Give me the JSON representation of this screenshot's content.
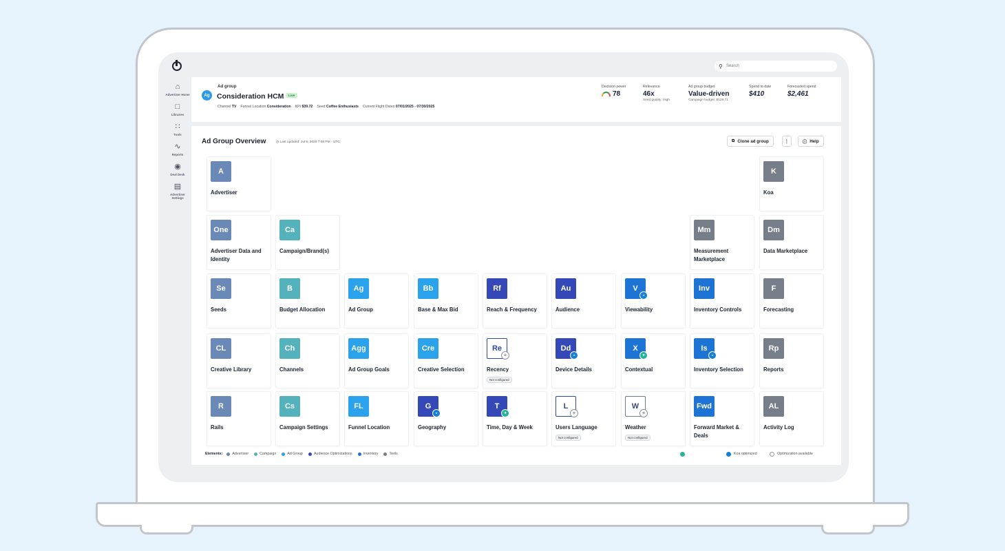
{
  "search": {
    "placeholder": "Search"
  },
  "sidebar": {
    "items": [
      {
        "label": "Advertiser Home",
        "icon": "home-icon"
      },
      {
        "label": "Libraries",
        "icon": "document-icon"
      },
      {
        "label": "Tools",
        "icon": "grid-icon"
      },
      {
        "label": "Reports",
        "icon": "chart-line-icon"
      },
      {
        "label": "Deal Desk",
        "icon": "deal-icon"
      },
      {
        "label": "Advertiser Settings",
        "icon": "settings-doc-icon"
      }
    ]
  },
  "header": {
    "ag_badge": "Ag",
    "type_label": "Ad group",
    "title": "Consideration HCM",
    "status": "Live",
    "meta": {
      "channel_label": "Channel",
      "channel": "TV",
      "funnel_label": "Funnel Location",
      "funnel": "Consideration",
      "kpi_label": "KPI",
      "kpi": "$39.72",
      "seed_label": "Seed",
      "seed": "Coffee Enthusiasts",
      "flight_label": "Current Flight Dates",
      "flight": "07/01/2025 - 07/30/2025"
    },
    "metrics": {
      "decision_power": {
        "label": "Decision power",
        "value": "78"
      },
      "relevance": {
        "label": "Relevance",
        "value": "46x",
        "sub": "Seed quality: High"
      },
      "budget": {
        "label": "Ad group budget",
        "value": "Value-driven",
        "sub": "Campaign budget: $129.71"
      },
      "spend": {
        "label": "Spend to date",
        "value": "$410"
      },
      "forecast": {
        "label": "Forecasted spend",
        "value": "$2,461"
      }
    }
  },
  "overview": {
    "title": "Ad Group Overview",
    "updated": "Last updated: Jul 8, 2025 7:08 PM - UTC",
    "clone_label": "Clone ad group",
    "help_label": "Help",
    "not_configured": "Not configured"
  },
  "tiles": {
    "advertiser": {
      "sym": "A",
      "name": "Advertiser"
    },
    "koa": {
      "sym": "K",
      "name": "Koa"
    },
    "advertiser_data": {
      "sym": "One",
      "name": "Advertiser Data and Identity"
    },
    "campaign_brand": {
      "sym": "Ca",
      "name": "Campaign/Brand(s)"
    },
    "measurement": {
      "sym": "Mm",
      "name": "Measurement Marketplace"
    },
    "data_marketplace": {
      "sym": "Dm",
      "name": "Data Marketplace"
    },
    "seeds": {
      "sym": "Se",
      "name": "Seeds"
    },
    "budget_allocation": {
      "sym": "B",
      "name": "Budget Allocation"
    },
    "ad_group": {
      "sym": "Ag",
      "name": "Ad Group"
    },
    "base_max_bid": {
      "sym": "Bb",
      "name": "Base & Max Bid"
    },
    "reach_frequency": {
      "sym": "Rf",
      "name": "Reach & Frequency"
    },
    "audience": {
      "sym": "Au",
      "name": "Audience"
    },
    "viewability": {
      "sym": "V",
      "name": "Viewability"
    },
    "inventory_controls": {
      "sym": "Inv",
      "name": "Inventory Controls"
    },
    "forecasting": {
      "sym": "F",
      "name": "Forecasting"
    },
    "creative_library": {
      "sym": "CL",
      "name": "Creative Library"
    },
    "channels": {
      "sym": "Ch",
      "name": "Channels"
    },
    "ad_group_goals": {
      "sym": "Agg",
      "name": "Ad Group Goals"
    },
    "creative_selection": {
      "sym": "Cre",
      "name": "Creative Selection"
    },
    "recency": {
      "sym": "Re",
      "name": "Recency"
    },
    "device_details": {
      "sym": "Dd",
      "name": "Device Details"
    },
    "contextual": {
      "sym": "X",
      "name": "Contextual"
    },
    "inventory_selection": {
      "sym": "Is",
      "name": "Inventory Selection"
    },
    "reports": {
      "sym": "Rp",
      "name": "Reports"
    },
    "rails": {
      "sym": "R",
      "name": "Rails"
    },
    "campaign_settings": {
      "sym": "Cs",
      "name": "Campaign Settings"
    },
    "funnel_location": {
      "sym": "FL",
      "name": "Funnel Location"
    },
    "geography": {
      "sym": "G",
      "name": "Geography"
    },
    "time_day_week": {
      "sym": "T",
      "name": "Time, Day & Week"
    },
    "users_language": {
      "sym": "L",
      "name": "Users Language"
    },
    "weather": {
      "sym": "W",
      "name": "Weather"
    },
    "forward_market": {
      "sym": "Fwd",
      "name": "Forward Market & Deals"
    },
    "activity_log": {
      "sym": "AL",
      "name": "Activity Log"
    }
  },
  "legend": {
    "title": "Elements:",
    "items": [
      "Advertiser",
      "Campaign",
      "Ad Group",
      "Audience Optimizations",
      "Inventory",
      "Tools"
    ],
    "koa_optimized": "Koa optimized",
    "optimization_available": "Optimization available"
  },
  "colors": {
    "advertiser": "#6a89b6",
    "campaign": "#54b2bd",
    "ad_group": "#2aa3ec",
    "audience_opt": "#3448b8",
    "inventory": "#1e74d4",
    "tools": "#767e89"
  }
}
